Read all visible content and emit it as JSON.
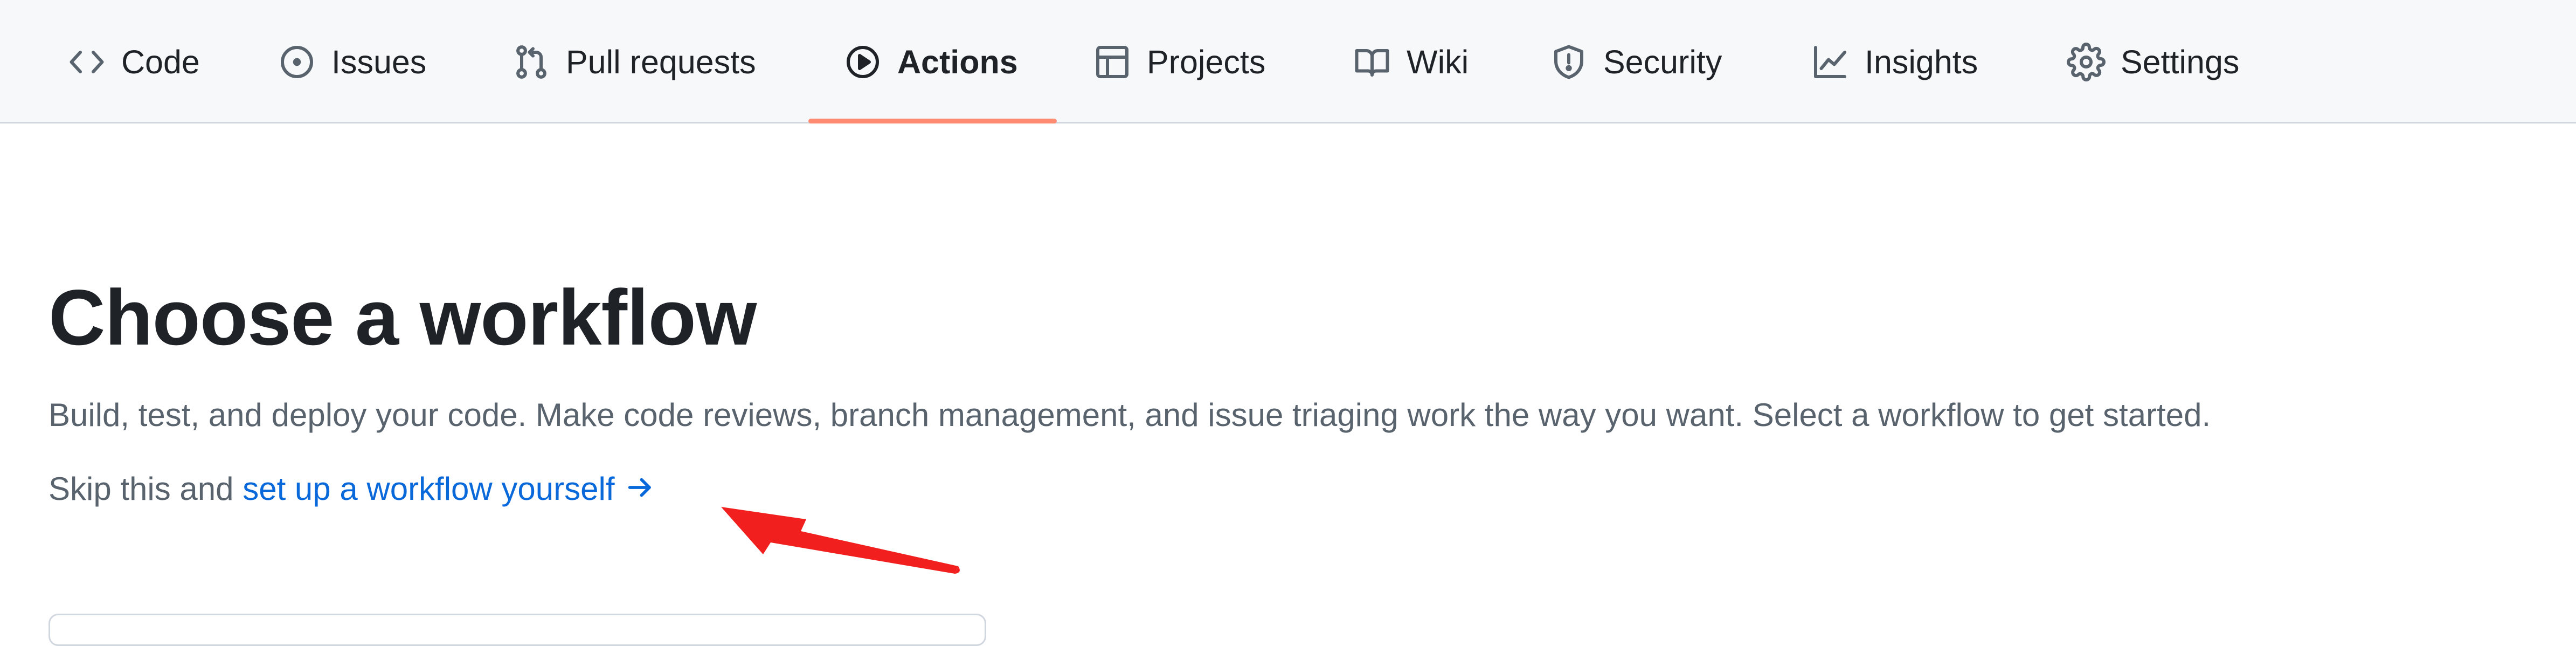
{
  "nav": {
    "tabs": [
      {
        "label": "Code",
        "icon": "code-icon"
      },
      {
        "label": "Issues",
        "icon": "issue-opened-icon"
      },
      {
        "label": "Pull requests",
        "icon": "git-pull-request-icon"
      },
      {
        "label": "Actions",
        "icon": "play-icon",
        "active": true
      },
      {
        "label": "Projects",
        "icon": "table-icon"
      },
      {
        "label": "Wiki",
        "icon": "book-icon"
      },
      {
        "label": "Security",
        "icon": "shield-icon"
      },
      {
        "label": "Insights",
        "icon": "graph-icon"
      },
      {
        "label": "Settings",
        "icon": "gear-icon"
      }
    ],
    "active_underline_color": "#fd8c73"
  },
  "main": {
    "title": "Choose a workflow",
    "description": "Build, test, and deploy your code. Make code reviews, branch management, and issue triaging work the way you want. Select a workflow to get started.",
    "skip_prefix": "Skip this and ",
    "skip_link": "set up a workflow yourself",
    "skip_link_icon": "arrow-right-icon"
  },
  "colors": {
    "link": "#0969da",
    "annotation": "#f21f1f",
    "nav_background": "#f6f8fa"
  }
}
